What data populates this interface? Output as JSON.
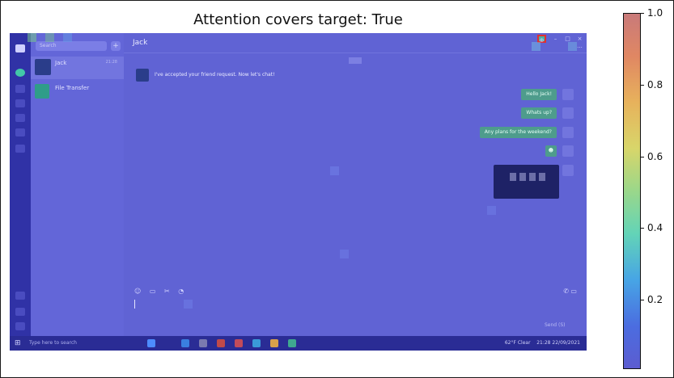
{
  "figure": {
    "title": "Attention covers target: True"
  },
  "colorbar": {
    "ticks": [
      "1.0",
      "0.8",
      "0.6",
      "0.4",
      "0.2"
    ],
    "gradient": [
      "#5c5cd0",
      "#47a5e5",
      "#63d4b7",
      "#d8d66a",
      "#e08763",
      "#c97a7a"
    ]
  },
  "app": {
    "search_placeholder": "Search",
    "add_symbol": "+",
    "chat_list": [
      {
        "name": "Jack",
        "time": "21:28"
      },
      {
        "name": "File Transfer"
      }
    ],
    "header": {
      "contact": "Jack",
      "more": "···"
    },
    "window_controls": {
      "pin": "⊕",
      "minimize": "–",
      "maximize": "□",
      "close": "×"
    },
    "incoming_message": "I've accepted your friend request. Now let's chat!",
    "outgoing_messages": [
      "Hello Jack!",
      "Whats up?",
      "Any plans for the weekend?"
    ],
    "sticker": "☻",
    "input_toolbar": "☺ ▭ ✂ ◔",
    "call_icons": "✆ ▭",
    "send_label": "Send (S)"
  },
  "taskbar": {
    "start": "⊞",
    "search_placeholder": "Type here to search",
    "weather": "62°F  Clear",
    "time": "21:28",
    "date": "22/09/2021"
  }
}
